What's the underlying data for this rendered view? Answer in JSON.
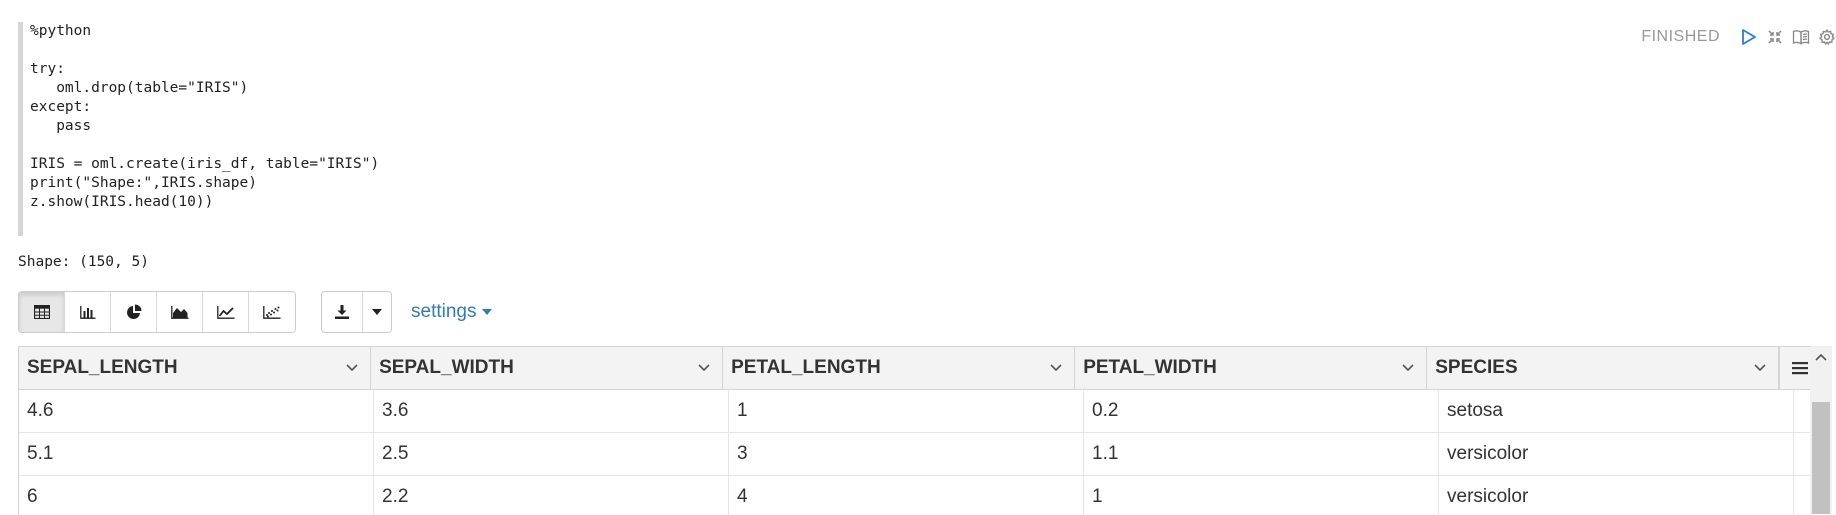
{
  "code": {
    "lines": [
      "%python",
      "",
      "try:",
      "   oml.drop(table=\"IRIS\")",
      "except:",
      "   pass",
      "",
      "IRIS = oml.create(iris_df, table=\"IRIS\")",
      "print(\"Shape:\",IRIS.shape)",
      "z.show(IRIS.head(10))"
    ]
  },
  "paragraph_header": {
    "status": "FINISHED",
    "icons": [
      "run-icon",
      "collapse-icon",
      "book-icon",
      "gear-icon"
    ]
  },
  "output": {
    "text": "Shape: (150, 5)"
  },
  "toolbar": {
    "views": [
      "table",
      "bar-chart",
      "pie-chart",
      "area-chart",
      "line-chart",
      "scatter-chart"
    ],
    "active_view": "table",
    "settings_label": "settings"
  },
  "table": {
    "columns": [
      "SEPAL_LENGTH",
      "SEPAL_WIDTH",
      "PETAL_LENGTH",
      "PETAL_WIDTH",
      "SPECIES"
    ],
    "rows": [
      [
        "4.6",
        "3.6",
        "1",
        "0.2",
        "setosa"
      ],
      [
        "5.1",
        "2.5",
        "3",
        "1.1",
        "versicolor"
      ],
      [
        "6",
        "2.2",
        "4",
        "1",
        "versicolor"
      ]
    ]
  },
  "colors": {
    "link": "#337ab7",
    "status": "#999999",
    "play": "#2a7fd4",
    "header_bg": "#f3f3f3"
  }
}
